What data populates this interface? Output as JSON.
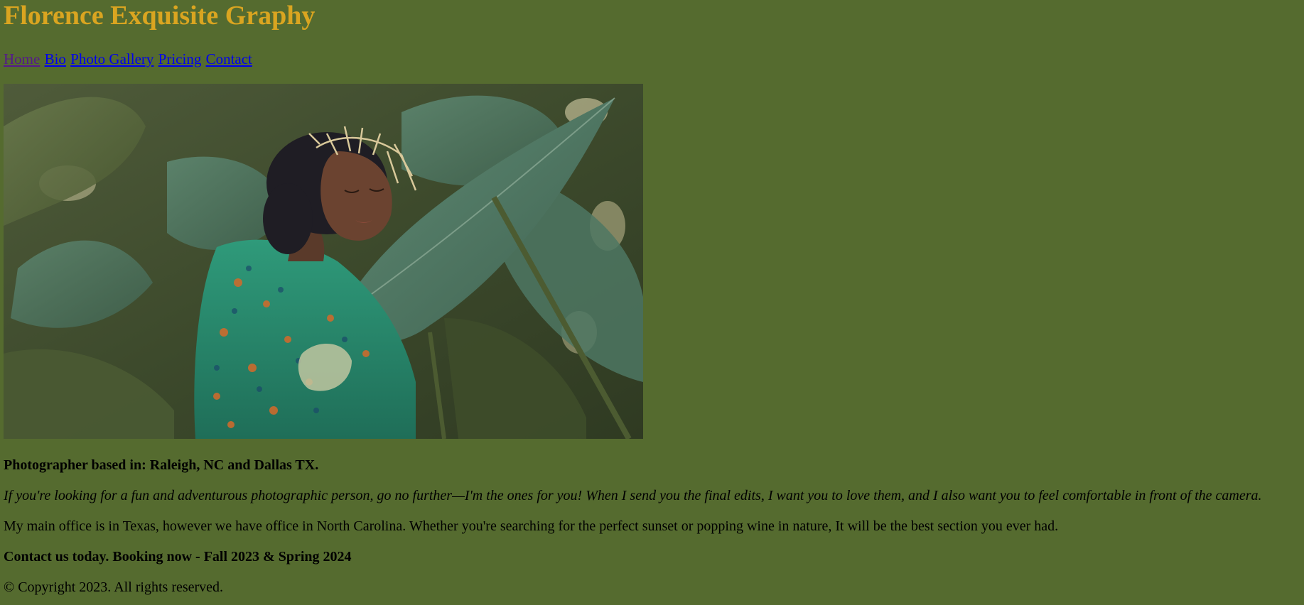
{
  "site": {
    "title": "Florence Exquisite Graphy"
  },
  "nav": {
    "items": [
      {
        "label": "Home"
      },
      {
        "label": "Bio"
      },
      {
        "label": "Photo Gallery"
      },
      {
        "label": "Pricing"
      },
      {
        "label": "Contact"
      }
    ]
  },
  "hero": {
    "alt": "Woman with eyes closed wearing a patterned green blouse and gold headpiece among large taro leaves"
  },
  "content": {
    "location": "Photographer based in: Raleigh, NC and Dallas TX.",
    "tagline": "If you're looking for a fun and adventurous photographic person, go no further—I'm the ones for you! When I send you the final edits, I want you to love them, and I also want you to feel comfortable in front of the camera.",
    "office": "My main office is in Texas, however we have office in North Carolina. Whether you're searching for the perfect sunset or popping wine in nature, It will be the best section you ever had.",
    "booking": "Contact us today. Booking now - Fall 2023 & Spring 2024",
    "copyright": "© Copyright 2023. All rights reserved."
  },
  "colors": {
    "background": "#556b2f",
    "title": "#daa520",
    "link": "#0000ee",
    "visited_link": "#551a8b"
  }
}
